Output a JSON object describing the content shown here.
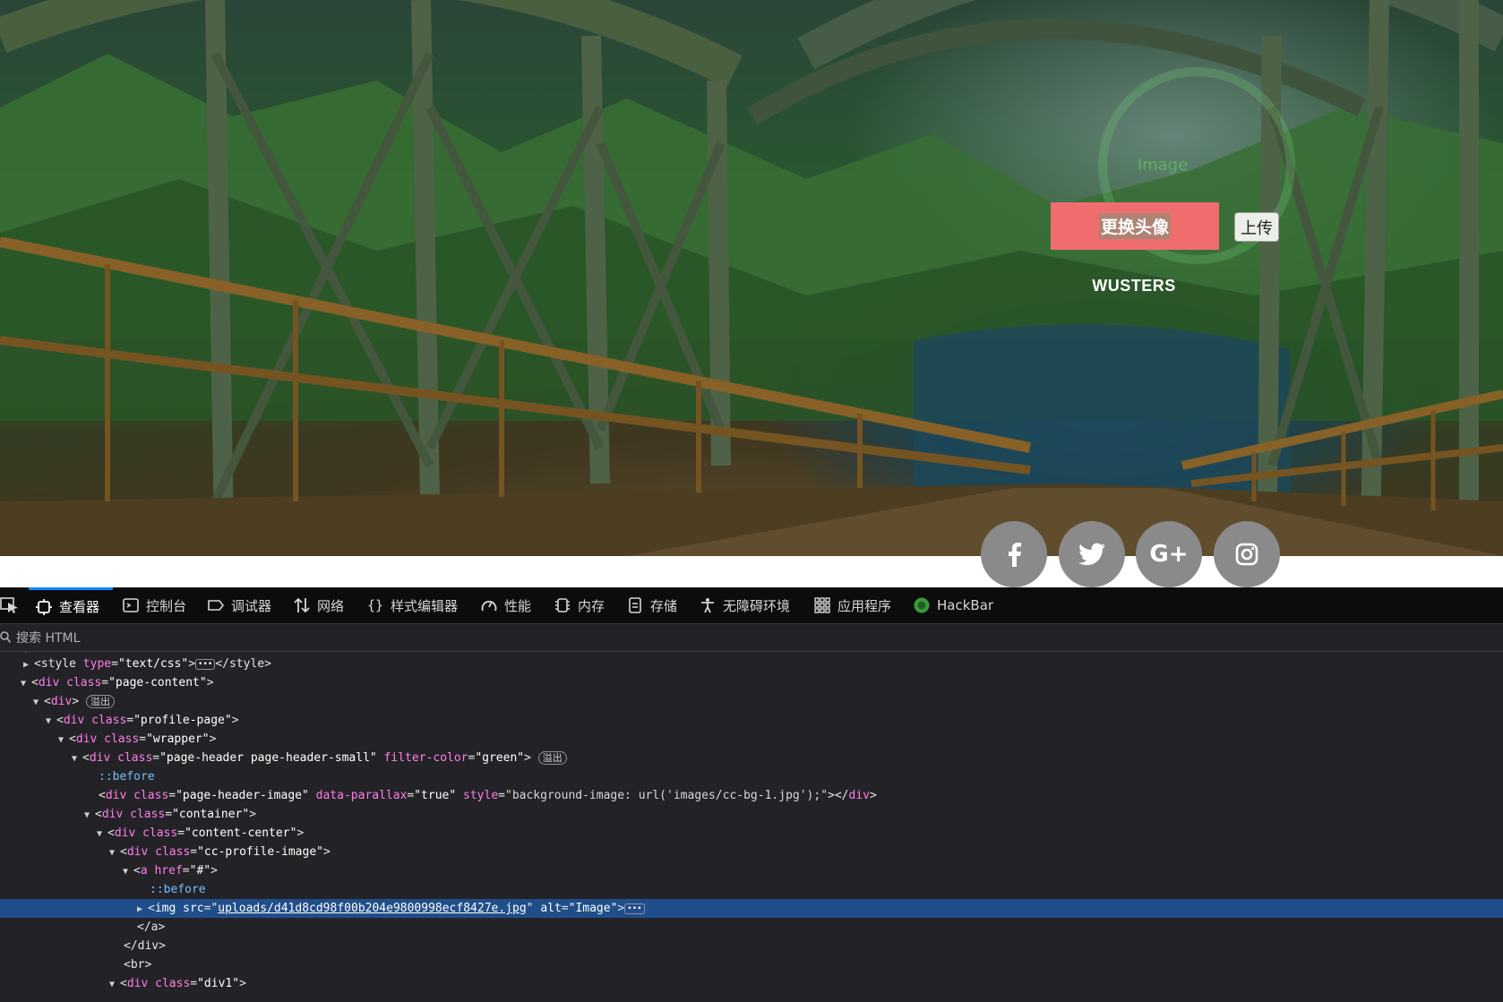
{
  "profile": {
    "avatar_alt": "Image",
    "change_avatar_label": "更换头像",
    "upload_label": "上传",
    "username": "WUSTERS"
  },
  "social_buttons": [
    {
      "icon": "facebook-icon",
      "glyph": "f"
    },
    {
      "icon": "twitter-icon",
      "glyph": "t"
    },
    {
      "icon": "google-plus-icon",
      "glyph": "G+"
    },
    {
      "icon": "instagram-icon",
      "glyph": "ig"
    }
  ],
  "devtools": {
    "tabs": [
      {
        "label": "查看器",
        "icon": "inspector-icon",
        "active": true
      },
      {
        "label": "控制台",
        "icon": "console-icon"
      },
      {
        "label": "调试器",
        "icon": "debugger-icon"
      },
      {
        "label": "网络",
        "icon": "network-icon"
      },
      {
        "label": "样式编辑器",
        "icon": "style-editor-icon"
      },
      {
        "label": "性能",
        "icon": "performance-icon"
      },
      {
        "label": "内存",
        "icon": "memory-icon"
      },
      {
        "label": "存储",
        "icon": "storage-icon"
      },
      {
        "label": "无障碍环境",
        "icon": "accessibility-icon"
      },
      {
        "label": "应用程序",
        "icon": "application-icon"
      },
      {
        "label": "HackBar",
        "icon": "hackbar-icon"
      }
    ],
    "search_placeholder": "搜索 HTML",
    "badge_overflow": "溢出",
    "tree": {
      "l0": "</style>",
      "l0_open": "<style",
      "l0_attr": "type",
      "l0_val": "\"text/css\"",
      "l1_tag": "div",
      "l1_class": "\"page-content\"",
      "l2_tag": "div",
      "l3_class": "\"profile-page\"",
      "l4_class": "\"wrapper\"",
      "l5_class": "\"page-header page-header-small\"",
      "l5_attr": "filter-color",
      "l5_val": "\"green\"",
      "l6_pseudo": "::before",
      "l7_class": "\"page-header-image\"",
      "l7_attr1": "data-parallax",
      "l7_val1": "\"true\"",
      "l7_attr2": "style",
      "l7_val2": "\"background-image: url('images/cc-bg-1.jpg');\"",
      "l8_class": "\"container\"",
      "l9_class": "\"content-center\"",
      "l10_class": "\"cc-profile-image\"",
      "l11_href": "\"#\"",
      "l12_pseudo": "::before",
      "l13_src": "uploads/d41d8cd98f00b204e9800998ecf8427e.jpg",
      "l13_alt": "\"Image\"",
      "l14_close": "</a>",
      "l15_close": "</div>",
      "l16_br": "<br>",
      "l17_class": "\"div1\""
    }
  }
}
